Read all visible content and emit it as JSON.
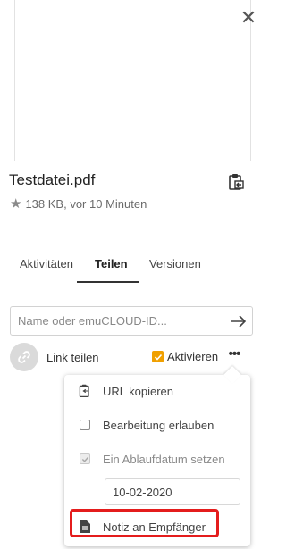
{
  "file": {
    "name": "Testdatei.pdf",
    "meta": "138 KB, vor 10 Minuten",
    "icons": {
      "close": "close-icon",
      "action": "clipboard-icon",
      "star": "star-icon"
    }
  },
  "tabs": [
    {
      "label": "Aktivitäten",
      "active": false
    },
    {
      "label": "Teilen",
      "active": true
    },
    {
      "label": "Versionen",
      "active": false
    }
  ],
  "share": {
    "placeholder": "Name oder emuCLOUD-ID...",
    "value": ""
  },
  "link": {
    "label": "Link teilen",
    "activate_label": "Aktivieren",
    "activate_checked": true
  },
  "menu": {
    "copy_url": "URL kopieren",
    "allow_edit": "Bearbeitung erlauben",
    "allow_edit_checked": false,
    "expiration": "Ein Ablaufdatum setzen",
    "expiration_checked": true,
    "expiration_date": "10-02-2020",
    "note": "Notiz an Empfänger"
  },
  "colors": {
    "accent": "#f0a000",
    "highlight": "#e41c1c"
  }
}
